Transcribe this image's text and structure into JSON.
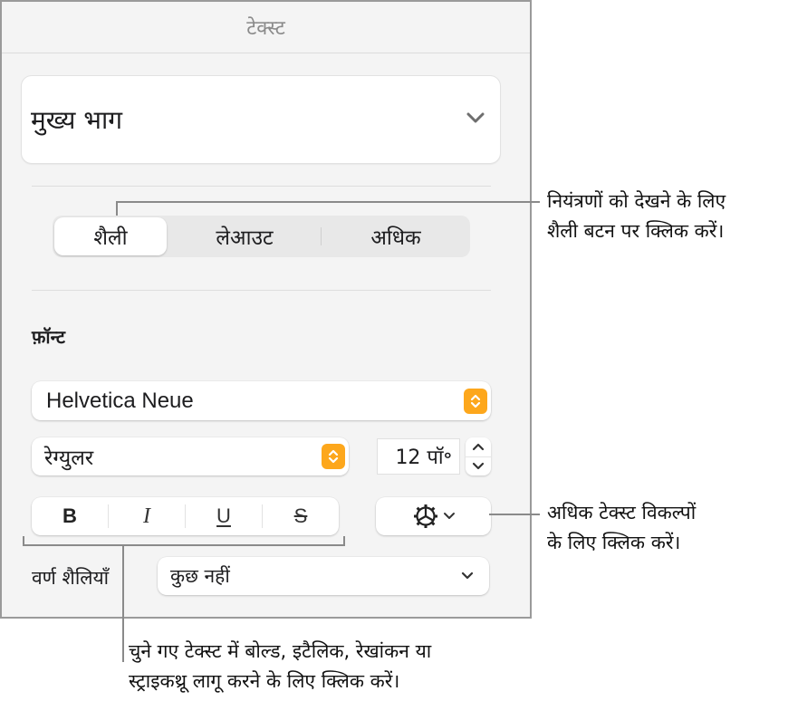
{
  "panel": {
    "title": "टेक्स्ट",
    "paragraph_style": "मुख्य भाग",
    "tabs": [
      {
        "label": "शैली",
        "active": true
      },
      {
        "label": "लेआउट",
        "active": false
      },
      {
        "label": "अधिक",
        "active": false
      }
    ],
    "font_section_label": "फ़ॉन्ट",
    "font_family": "Helvetica Neue",
    "font_typeface": "रेग्युलर",
    "font_size": "12 पॉ॰",
    "style_buttons": {
      "bold": "B",
      "italic": "I",
      "underline": "U",
      "strikethrough": "S"
    },
    "character_styles_label": "वर्ण शैलियाँ",
    "character_style_value": "कुछ नहीं",
    "accent_color": "#fda71c"
  },
  "callouts": {
    "style_tab": [
      "नियंत्रणों को देखने के लिए",
      "शैली बटन पर क्लिक करें।"
    ],
    "more_options": [
      "अधिक टेक्स्ट विकल्पों",
      "के लिए क्लिक करें।"
    ],
    "biu": [
      "चुने गए टेक्स्ट में बोल्ड, इटैलिक, रेखांकन या",
      "स्ट्राइकथ्रू लागू करने के लिए क्लिक करें।"
    ]
  }
}
